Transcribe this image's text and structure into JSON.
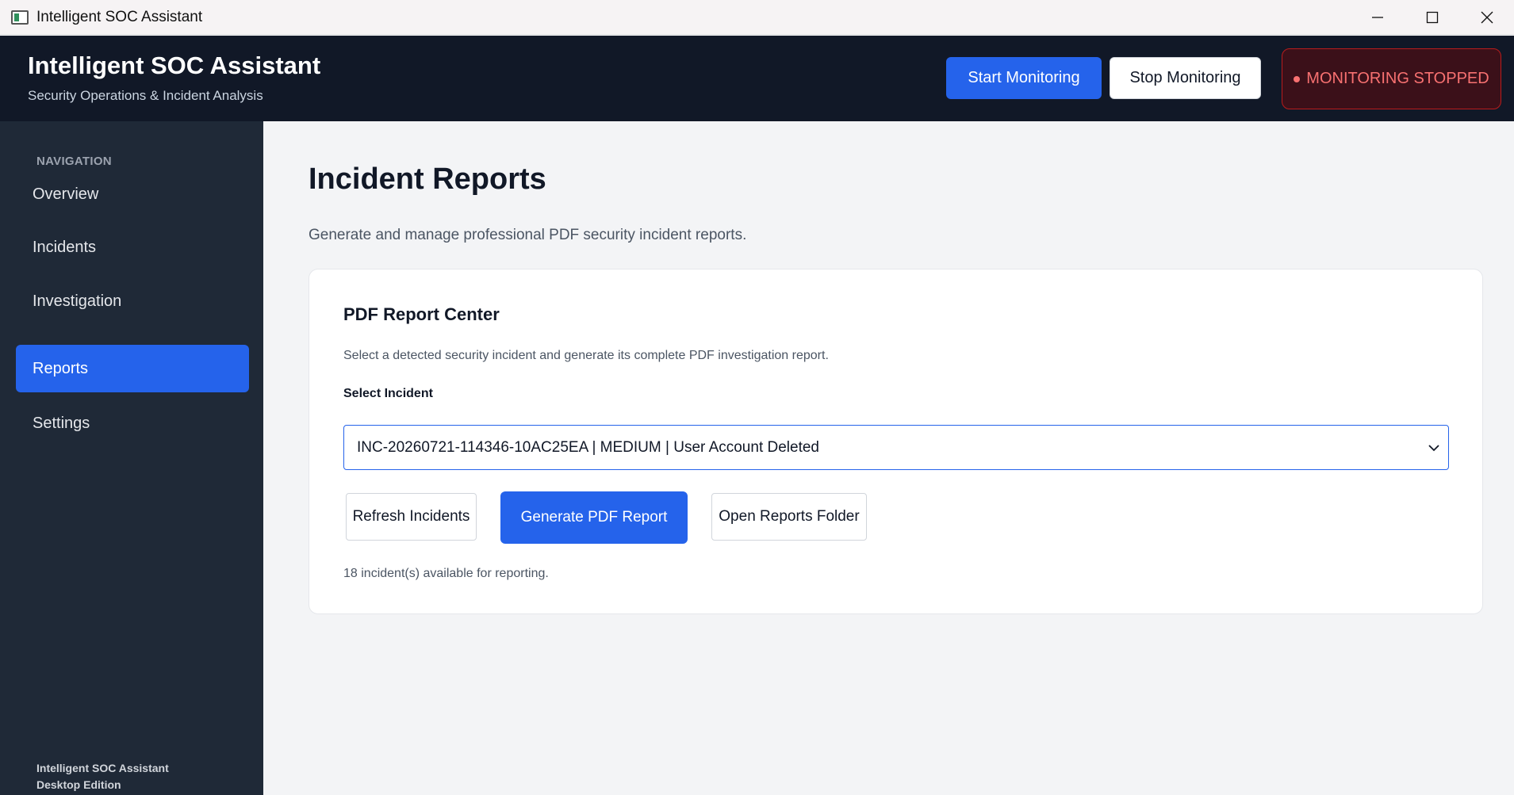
{
  "window": {
    "title": "Intelligent SOC Assistant"
  },
  "header": {
    "title": "Intelligent SOC Assistant",
    "subtitle": "Security Operations & Incident Analysis",
    "start_label": "Start Monitoring",
    "stop_label": "Stop Monitoring",
    "status_label": "MONITORING STOPPED"
  },
  "sidebar": {
    "heading": "NAVIGATION",
    "items": [
      {
        "label": "Overview",
        "active": false
      },
      {
        "label": "Incidents",
        "active": false
      },
      {
        "label": "Investigation",
        "active": false
      },
      {
        "label": "Reports",
        "active": true
      },
      {
        "label": "Settings",
        "active": false
      }
    ],
    "footer_line1": "Intelligent SOC Assistant",
    "footer_line2": "Desktop Edition"
  },
  "main": {
    "title": "Incident Reports",
    "subtitle": "Generate and manage professional PDF security incident reports.",
    "card": {
      "title": "PDF Report Center",
      "description": "Select a detected security incident and generate its complete PDF investigation report.",
      "select_label": "Select Incident",
      "selected_incident": "INC-20260721-114346-10AC25EA  |  MEDIUM  |  User Account Deleted",
      "refresh_label": "Refresh Incidents",
      "generate_label": "Generate PDF Report",
      "open_folder_label": "Open Reports Folder",
      "status_text": "18 incident(s) available for reporting."
    }
  },
  "colors": {
    "accent": "#2563eb",
    "header_bg": "#111827",
    "sidebar_bg": "#1f2937",
    "status_red": "#f87171"
  }
}
